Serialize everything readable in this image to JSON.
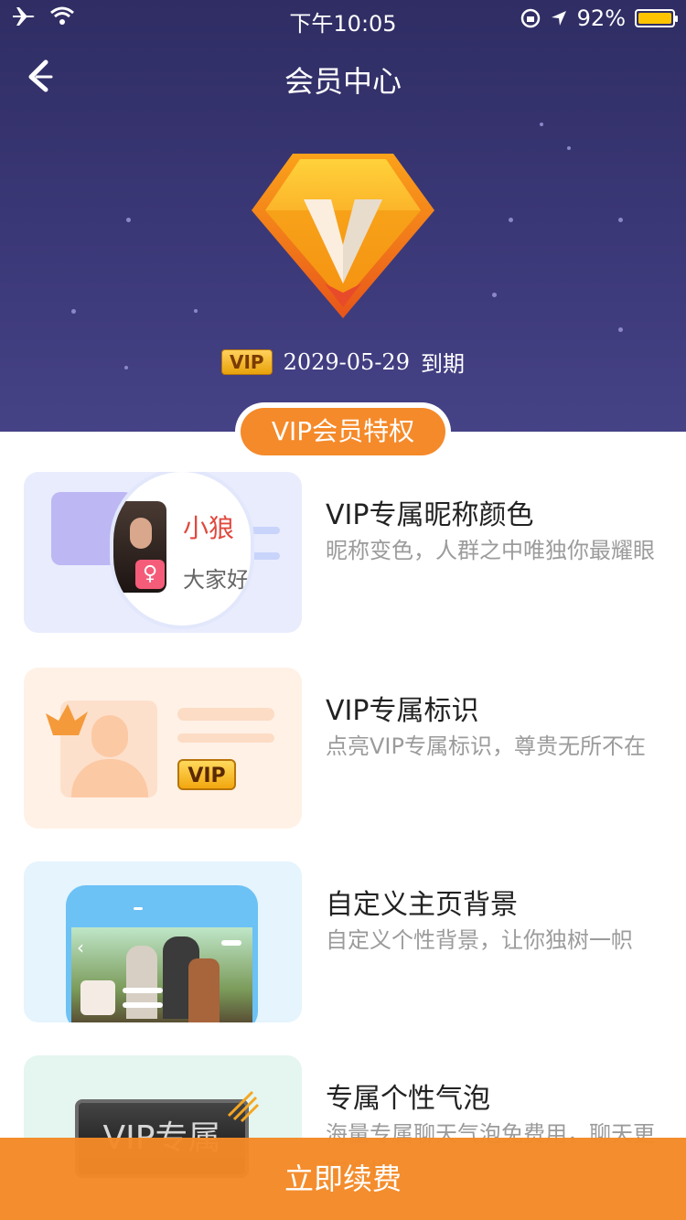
{
  "status_bar": {
    "time": "下午10:05",
    "battery": "92%"
  },
  "header": {
    "title": "会员中心",
    "vip_badge": "VIP",
    "expire_date": "2029-05-29",
    "expire_suffix": "到期"
  },
  "section_title": "VIP会员特权",
  "features": [
    {
      "title": "VIP专属昵称颜色",
      "desc": "昵称变色，人群之中唯独你最耀眼",
      "card_name": "小狼",
      "card_greeting": "大家好我"
    },
    {
      "title": "VIP专属标识",
      "desc": "点亮VIP专属标识，尊贵无所不在",
      "badge": "VIP"
    },
    {
      "title": "自定义主页背景",
      "desc": "自定义个性背景，让你独树一帜"
    },
    {
      "title": "专属个性气泡",
      "desc": "海量专属聊天气泡免费用，聊天更有个性",
      "bubble_text": "VIP专属"
    }
  ],
  "cta_label": "立即续费",
  "colors": {
    "header_bg": "#38356f",
    "accent": "#f58a2a",
    "nick_color": "#e0493e"
  }
}
